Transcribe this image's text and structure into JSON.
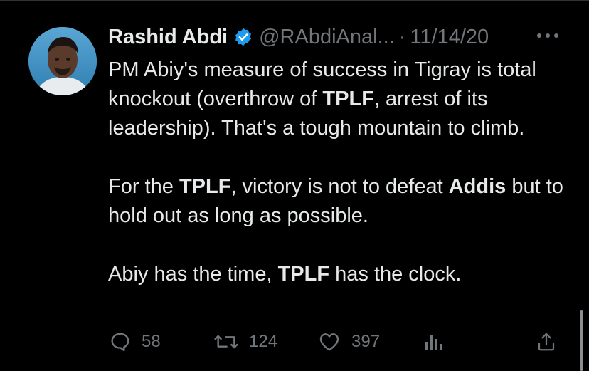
{
  "tweet": {
    "author": {
      "display_name": "Rashid Abdi",
      "handle": "@RAbdiAnal...",
      "verified": true,
      "avatar_icon": "user-avatar"
    },
    "separator": "·",
    "timestamp": "11/14/20",
    "paragraphs": [
      [
        {
          "text": "PM Abiy's measure of success in Tigray is total knockout (overthrow of ",
          "bold": false
        },
        {
          "text": "TPLF",
          "bold": true
        },
        {
          "text": ", arrest of its leadership). That's a tough mountain to climb.",
          "bold": false
        }
      ],
      [
        {
          "text": "For the ",
          "bold": false
        },
        {
          "text": "TPLF",
          "bold": true
        },
        {
          "text": ", victory is not to defeat ",
          "bold": false
        },
        {
          "text": "Addis",
          "bold": true
        },
        {
          "text": " but to hold out as long as possible.",
          "bold": false
        }
      ],
      [
        {
          "text": "Abiy has the time, ",
          "bold": false
        },
        {
          "text": "TPLF",
          "bold": true
        },
        {
          "text": " has the clock.",
          "bold": false
        }
      ]
    ],
    "actions": {
      "reply": {
        "icon": "reply-icon",
        "count": "58"
      },
      "retweet": {
        "icon": "retweet-icon",
        "count": "124"
      },
      "like": {
        "icon": "heart-icon",
        "count": "397"
      },
      "analytics": {
        "icon": "analytics-icon"
      },
      "share": {
        "icon": "share-icon"
      }
    }
  },
  "colors": {
    "background": "#000000",
    "text_primary": "#e7e9ea",
    "text_secondary": "#71767b",
    "verified_badge": "#1d9bf0"
  }
}
